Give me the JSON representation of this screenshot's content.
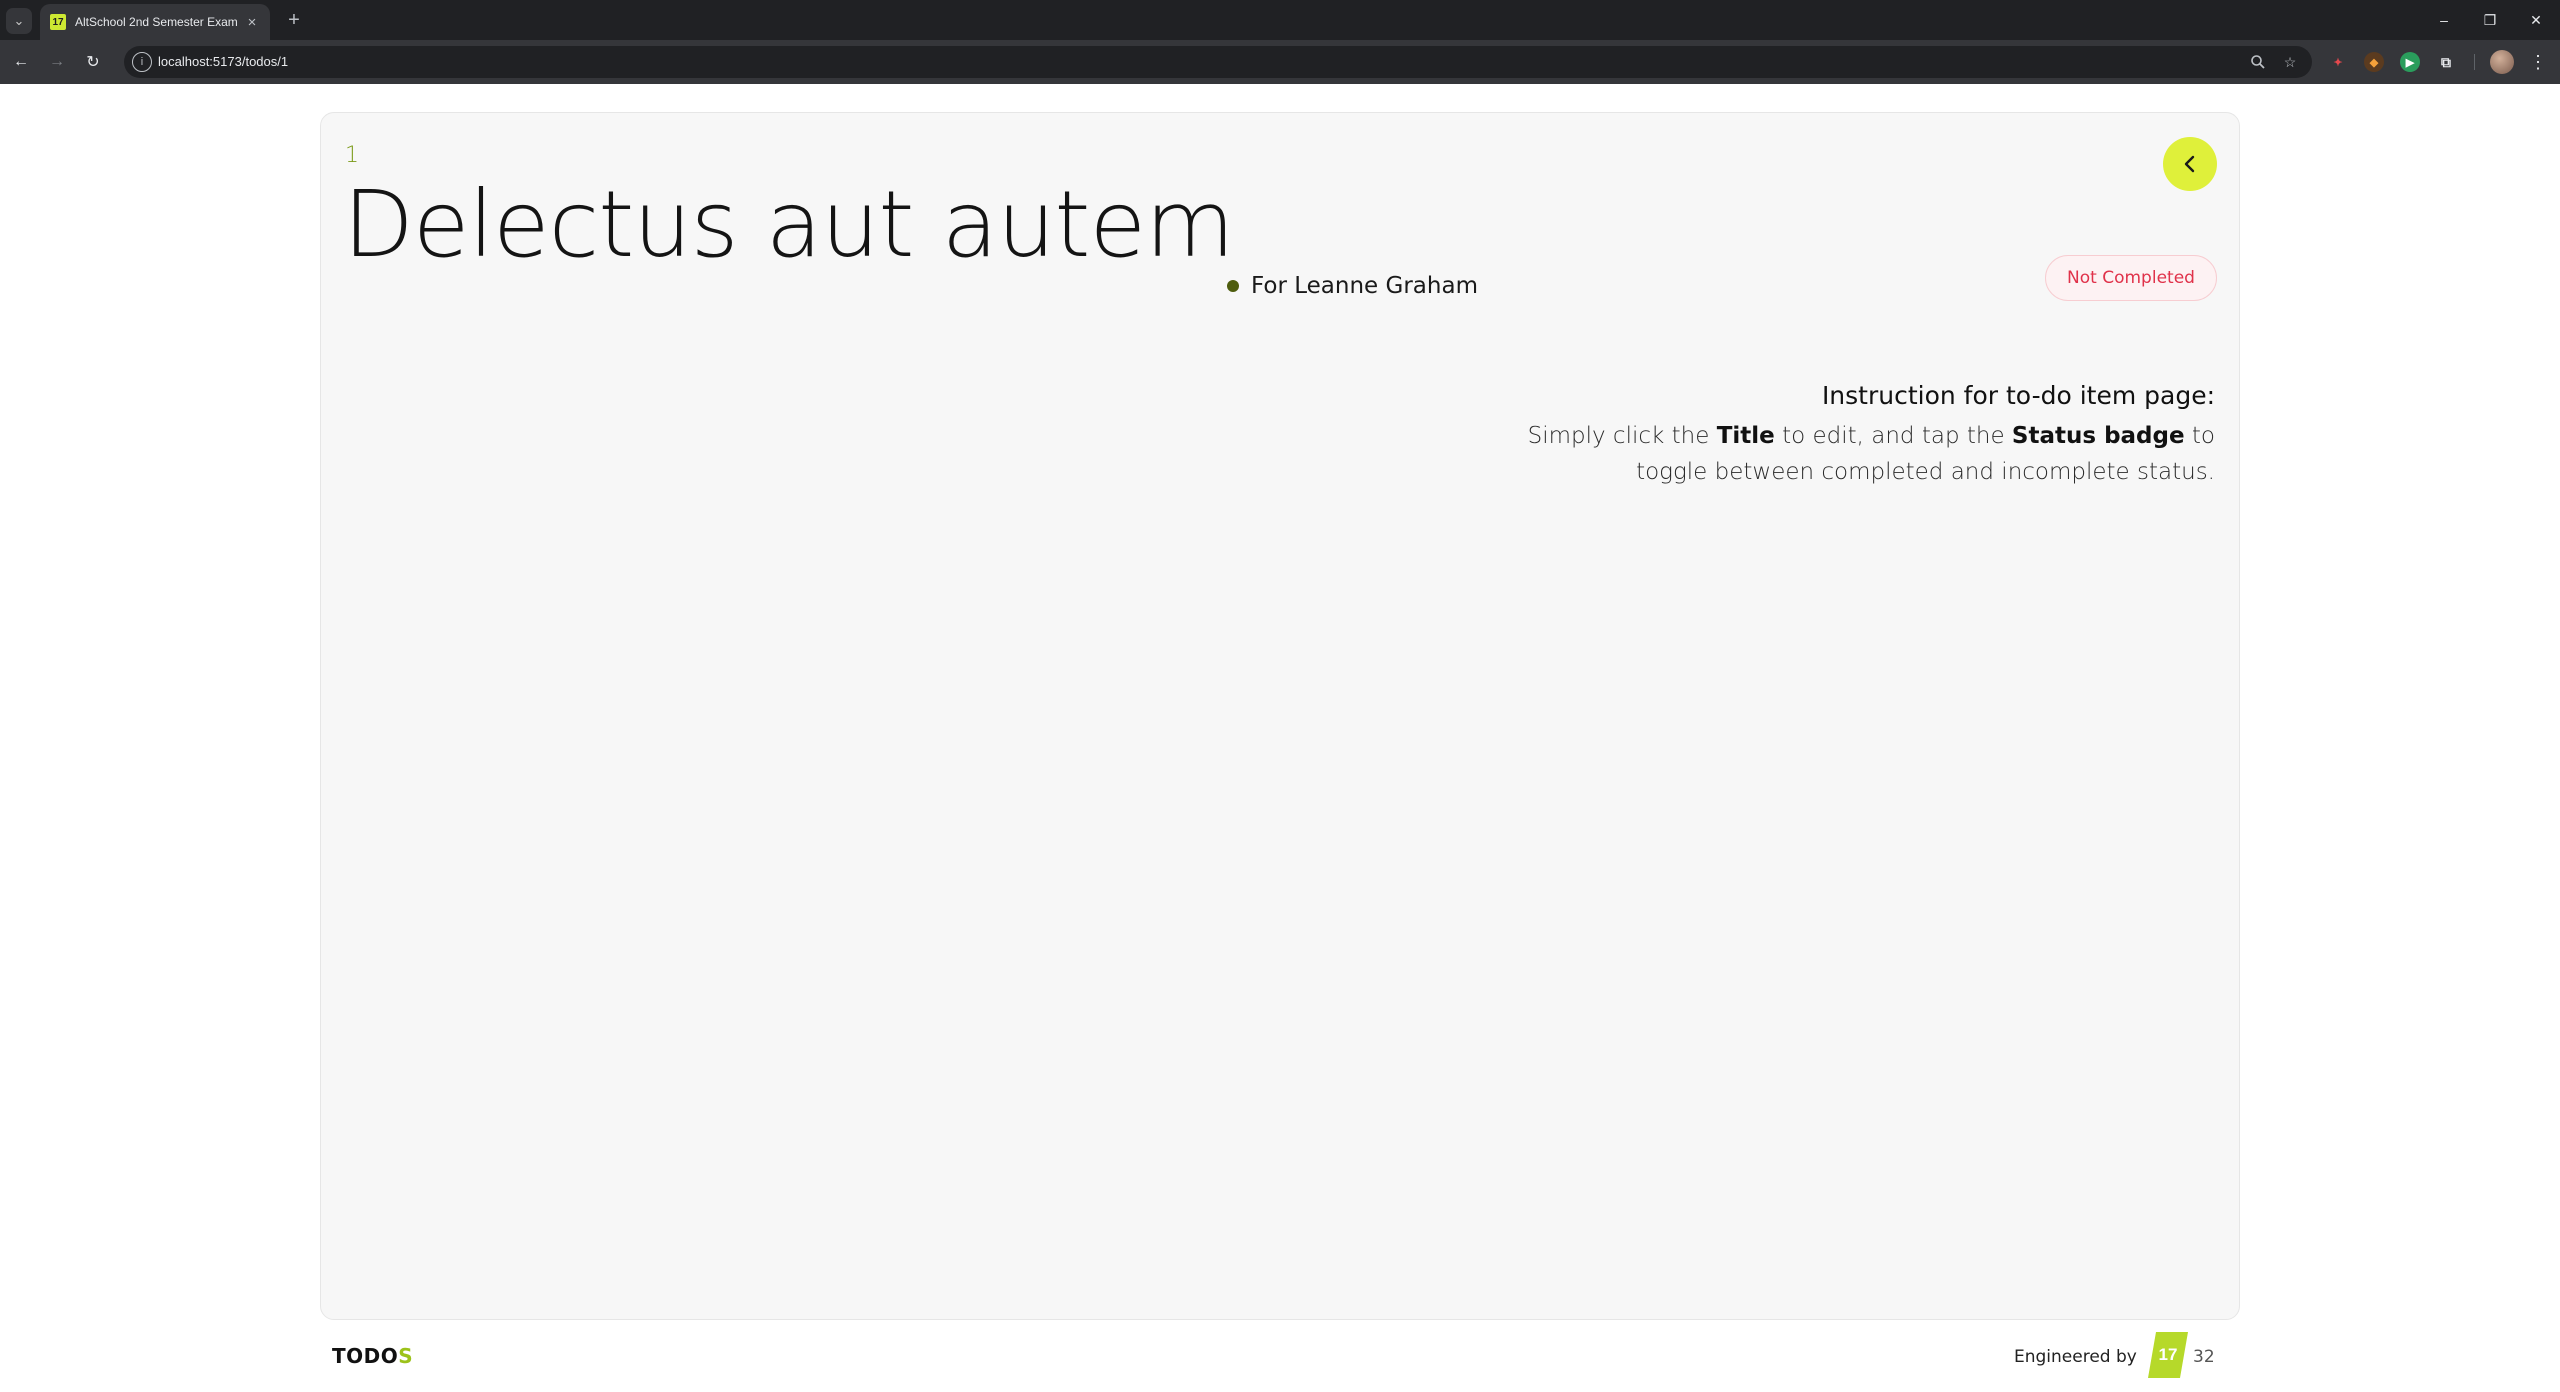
{
  "browser": {
    "tab_title": "AltSchool 2nd Semester Exam",
    "favicon_text": "17",
    "url": "localhost:5173/todos/1",
    "icons": {
      "tab_list": "chevron-down-icon",
      "close_tab": "close-icon",
      "new_tab": "plus-icon",
      "back": "arrow-left-icon",
      "forward": "arrow-right-icon",
      "reload": "reload-icon",
      "site_info": "info-icon",
      "zoom": "zoom-icon",
      "bookmark": "star-icon",
      "extensions": "puzzle-icon",
      "menu": "more-vertical-icon"
    }
  },
  "todo": {
    "id": "1",
    "title": "Delectus aut autem",
    "assignee": "For Leanne Graham",
    "status": "Not Completed"
  },
  "instructions": {
    "heading": "Instruction for to-do item page:",
    "text_1": "Simply click the ",
    "bold_1": "Title",
    "text_2": " to edit, and tap the ",
    "bold_2": "Status badge",
    "text_3": " to toggle between completed and incomplete status."
  },
  "footer": {
    "brand_main": "TODO",
    "brand_accent": "S",
    "engineered_by": "Engineered by",
    "logo_text": "17",
    "logo_number": "32"
  },
  "colors": {
    "accent": "#dff03a",
    "status_not_completed": "#e0324a",
    "id_color": "#7b9a18"
  }
}
